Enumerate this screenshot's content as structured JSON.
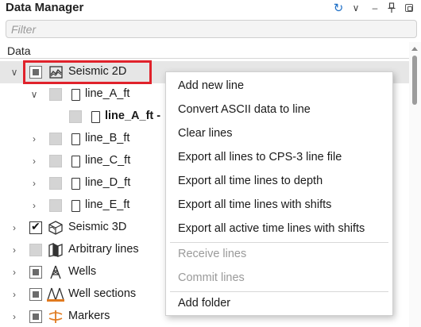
{
  "header": {
    "title": "Data Manager",
    "icons": [
      "refresh-icon",
      "chevron-down-icon",
      "minimize-icon",
      "pin-icon",
      "maximize-icon"
    ]
  },
  "filter": {
    "placeholder": "Filter",
    "value": ""
  },
  "columns": {
    "data": "Data"
  },
  "tree": {
    "seismic2d": {
      "label": "Seismic 2D",
      "check": "partial",
      "expanded": true,
      "icon": "seismic-2d-icon"
    },
    "line_a_ft": {
      "label": "line_A_ft",
      "expanded": true
    },
    "line_a_ft_child": {
      "label": "line_A_ft -"
    },
    "line_b_ft": {
      "label": "line_B_ft"
    },
    "line_c_ft": {
      "label": "line_C_ft"
    },
    "line_d_ft": {
      "label": "line_D_ft"
    },
    "line_e_ft": {
      "label": "line_E_ft"
    },
    "seismic3d": {
      "label": "Seismic 3D",
      "check": "checked",
      "icon": "seismic-3d-icon"
    },
    "arbitrary": {
      "label": "Arbitrary lines",
      "check": "unchecked",
      "icon": "arbitrary-lines-icon"
    },
    "wells": {
      "label": "Wells",
      "check": "partial",
      "icon": "well-icon"
    },
    "well_sections": {
      "label": "Well sections",
      "check": "partial",
      "icon": "well-sections-icon"
    },
    "markers": {
      "label": "Markers",
      "check": "partial",
      "icon": "markers-icon"
    }
  },
  "context_menu": {
    "add_new_line": "Add new line",
    "convert_ascii": "Convert ASCII data to line",
    "clear_lines": "Clear lines",
    "export_cps3": "Export all lines to CPS-3 line file",
    "export_time_depth": "Export all time lines to depth",
    "export_time_shifts": "Export all time lines with shifts",
    "export_active_shifts": "Export all active time lines with shifts",
    "receive_lines": "Receive lines",
    "commit_lines": "Commit lines",
    "add_folder": "Add folder"
  },
  "colors": {
    "accent": "#1e6fc6",
    "highlight_border": "#e0222b",
    "selected_row": "#e6e6e6",
    "disabled_text": "#9a9a9a"
  }
}
